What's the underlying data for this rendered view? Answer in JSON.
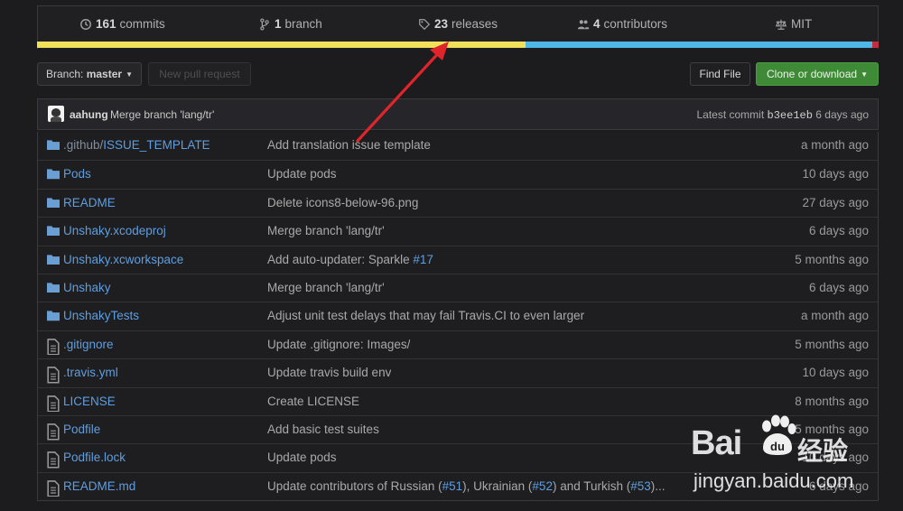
{
  "stats": {
    "commits": {
      "count": "161",
      "label": "commits",
      "icon": "history-icon"
    },
    "branches": {
      "count": "1",
      "label": "branch",
      "icon": "branch-icon"
    },
    "releases": {
      "count": "23",
      "label": "releases",
      "icon": "tag-icon"
    },
    "contributors": {
      "count": "4",
      "label": "contributors",
      "icon": "people-icon"
    },
    "license": {
      "label": "MIT",
      "icon": "law-icon"
    }
  },
  "language_bar": {
    "segments": [
      {
        "color": "#f1e05a",
        "percent": 58.0
      },
      {
        "color": "#4fb6e8",
        "percent": 41.3
      },
      {
        "color": "#c22d40",
        "percent": 0.7
      }
    ]
  },
  "toolbar": {
    "branch_prefix": "Branch:",
    "branch_name": "master",
    "new_pr_label": "New pull request",
    "find_file_label": "Find File",
    "clone_label": "Clone or download"
  },
  "latest_commit": {
    "author": "aahung",
    "message": "Merge branch 'lang/tr'",
    "latest_label": "Latest commit",
    "sha": "b3ee1eb",
    "age": "6 days ago"
  },
  "files": [
    {
      "type": "dir",
      "prefix": ".github/",
      "name": "ISSUE_TEMPLATE",
      "message": "Add translation issue template",
      "age": "a month ago"
    },
    {
      "type": "dir",
      "prefix": "",
      "name": "Pods",
      "message": "Update pods",
      "age": "10 days ago"
    },
    {
      "type": "dir",
      "prefix": "",
      "name": "README",
      "message": "Delete icons8-below-96.png",
      "age": "27 days ago"
    },
    {
      "type": "dir",
      "prefix": "",
      "name": "Unshaky.xcodeproj",
      "message": "Merge branch 'lang/tr'",
      "age": "6 days ago"
    },
    {
      "type": "dir",
      "prefix": "",
      "name": "Unshaky.xcworkspace",
      "message": "Add auto-updater: Sparkle ",
      "link": "#17",
      "age": "5 months ago"
    },
    {
      "type": "dir",
      "prefix": "",
      "name": "Unshaky",
      "message": "Merge branch 'lang/tr'",
      "age": "6 days ago"
    },
    {
      "type": "dir",
      "prefix": "",
      "name": "UnshakyTests",
      "message": "Adjust unit test delays that may fail Travis.CI to even larger",
      "age": "a month ago"
    },
    {
      "type": "file",
      "prefix": "",
      "name": ".gitignore",
      "message": "Update .gitignore: Images/",
      "age": "5 months ago"
    },
    {
      "type": "file",
      "prefix": "",
      "name": ".travis.yml",
      "message": "Update travis build env",
      "age": "10 days ago"
    },
    {
      "type": "file",
      "prefix": "",
      "name": "LICENSE",
      "message": "Create LICENSE",
      "age": "8 months ago"
    },
    {
      "type": "file",
      "prefix": "",
      "name": "Podfile",
      "message": "Add basic test suites",
      "age": "5 months ago"
    },
    {
      "type": "file",
      "prefix": "",
      "name": "Podfile.lock",
      "message": "Update pods",
      "age": "10 days ago"
    },
    {
      "type": "file",
      "prefix": "",
      "name": "README.md",
      "message_parts": [
        "Update contributors of Russian (",
        "#51",
        "), Ukrainian (",
        "#52",
        ") and Turkish (",
        "#53",
        ")..."
      ],
      "age": "6 days ago"
    }
  ],
  "annotation": {
    "color": "#e0242b"
  },
  "watermark": {
    "brand_left": "Bai",
    "brand_right": "经验",
    "url": "jingyan.baidu.com"
  }
}
